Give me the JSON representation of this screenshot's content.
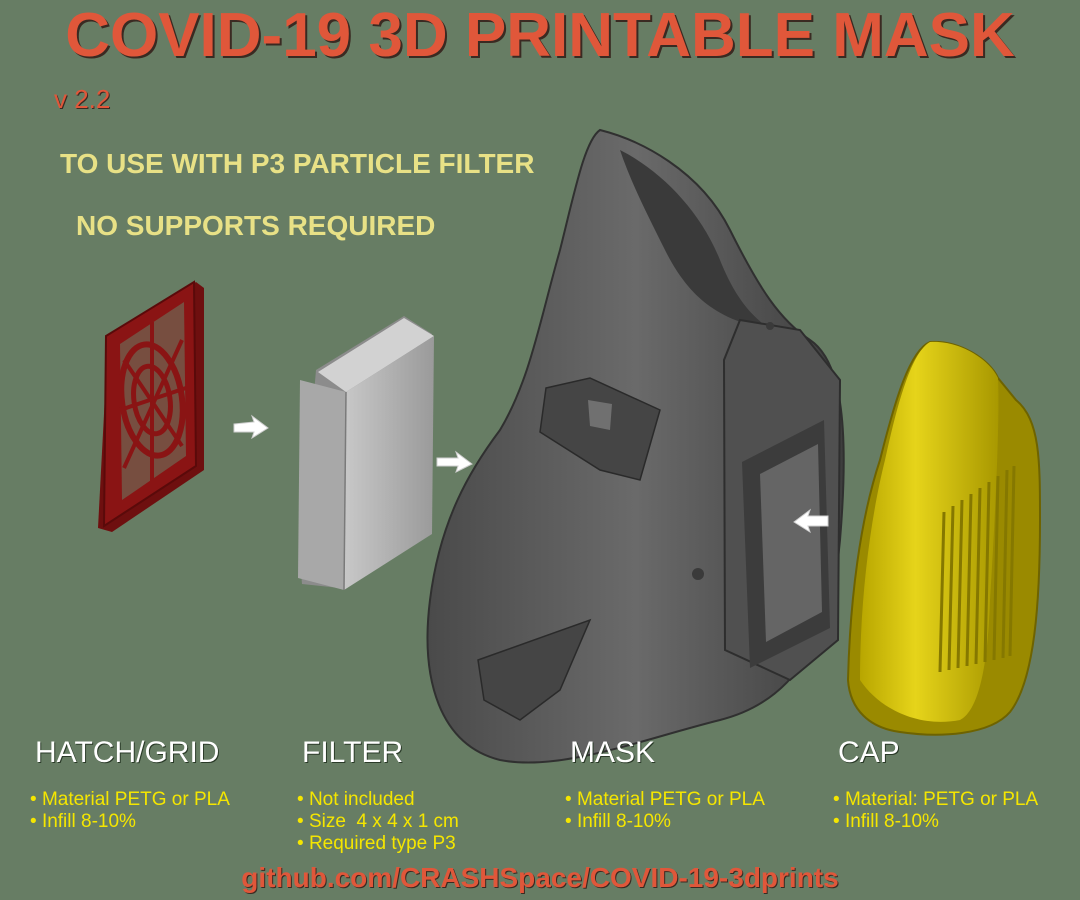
{
  "title": "COVID-19 3D PRINTABLE MASK",
  "version": "v 2.2",
  "notes": [
    "TO USE WITH P3 PARTICLE FILTER",
    "NO SUPPORTS REQUIRED"
  ],
  "parts": [
    {
      "name": "HATCH/GRID",
      "specs": [
        "Material PETG or PLA",
        "Infill 8-10%"
      ]
    },
    {
      "name": "FILTER",
      "specs": [
        "Not included",
        "Size  4 x 4 x 1 cm",
        "Required type P3"
      ]
    },
    {
      "name": "MASK",
      "specs": [
        "Material PETG or PLA",
        "Infill 8-10%"
      ]
    },
    {
      "name": "CAP",
      "specs": [
        "Material: PETG or PLA",
        "Infill 8-10%"
      ]
    }
  ],
  "footer": "github.com/CRASHSpace/COVID-19-3dprints",
  "colors": {
    "background": "#677d64",
    "title": "#e0573a",
    "notes": "#e8e186",
    "specs": "#f5e600",
    "hatch": "#8a1414",
    "filter": "#b4b4b4",
    "mask": "#5a5a5a",
    "cap": "#c9b800"
  }
}
